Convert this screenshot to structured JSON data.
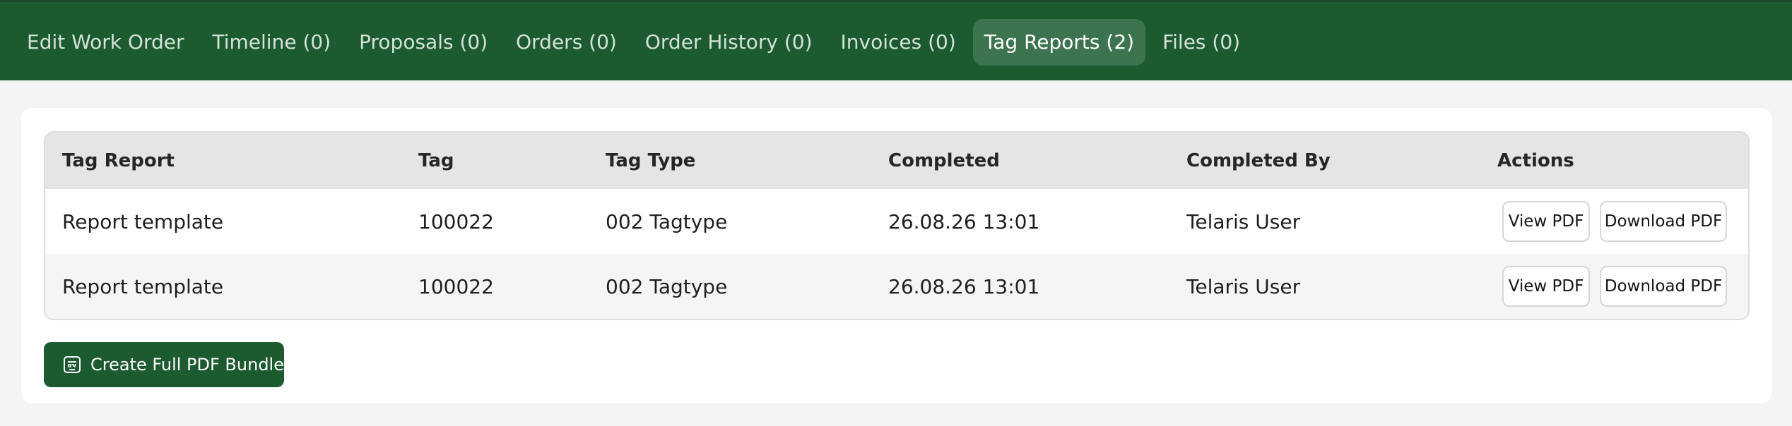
{
  "tabs": [
    {
      "label": "Edit Work Order",
      "active": false
    },
    {
      "label": "Timeline (0)",
      "active": false
    },
    {
      "label": "Proposals (0)",
      "active": false
    },
    {
      "label": "Orders (0)",
      "active": false
    },
    {
      "label": "Order History (0)",
      "active": false
    },
    {
      "label": "Invoices (0)",
      "active": false
    },
    {
      "label": "Tag Reports (2)",
      "active": true
    },
    {
      "label": "Files (0)",
      "active": false
    }
  ],
  "table": {
    "headers": [
      "Tag Report",
      "Tag",
      "Tag Type",
      "Completed",
      "Completed By",
      "Actions"
    ],
    "rows": [
      {
        "report": "Report template",
        "tag": "100022",
        "tag_type": "002 Tagtype",
        "completed": "26.08.26 13:01",
        "completed_by": "Telaris User",
        "view_label": "View PDF",
        "download_label": "Download PDF"
      },
      {
        "report": "Report template",
        "tag": "100022",
        "tag_type": "002 Tagtype",
        "completed": "26.08.26 13:01",
        "completed_by": "Telaris User",
        "view_label": "View PDF",
        "download_label": "Download PDF"
      }
    ]
  },
  "bundle_button": {
    "label": "Create Full PDF Bundle",
    "icon": "pdf-document-icon"
  },
  "colors": {
    "brand_green": "#1c5a30",
    "active_tab": "#3d7450",
    "header_bg": "#e5e5e5"
  }
}
